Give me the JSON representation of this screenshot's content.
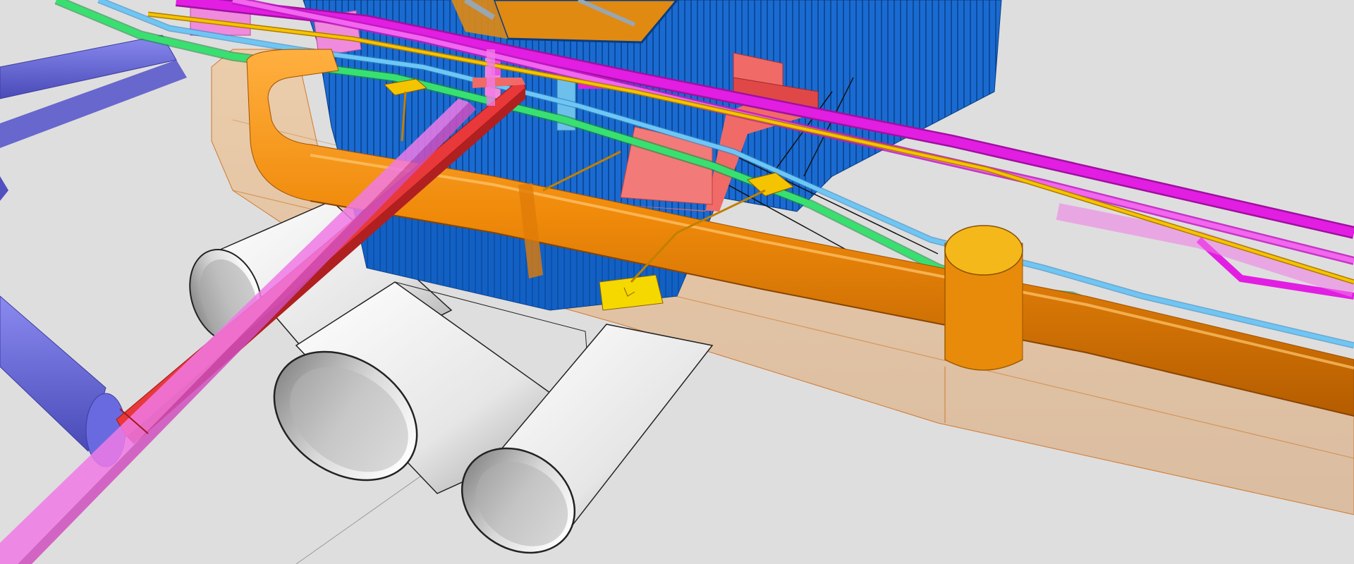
{
  "viewport": {
    "background": "#dedede",
    "scene": "bim-utilities-model"
  },
  "colors": {
    "diaphragm_wall": "#1a6bd1",
    "wall_dark": "#0d4a9c",
    "orange_main": "#f08a0a",
    "orange_dark": "#c86a00",
    "orange_ghost": "#e8b482",
    "magenta": "#e21ee2",
    "pink": "#f07ae6",
    "red": "#e8383a",
    "salmon": "#f06a68",
    "green": "#38e070",
    "light_blue": "#5fb6f0",
    "purple_blue": "#6464dc",
    "yellow": "#f5c400",
    "tunnel": "#f4f4f4",
    "tunnel_edge": "#222222"
  },
  "icons": [
    "valve-marker-icon",
    "valve-marker-icon",
    "valve-marker-icon"
  ]
}
